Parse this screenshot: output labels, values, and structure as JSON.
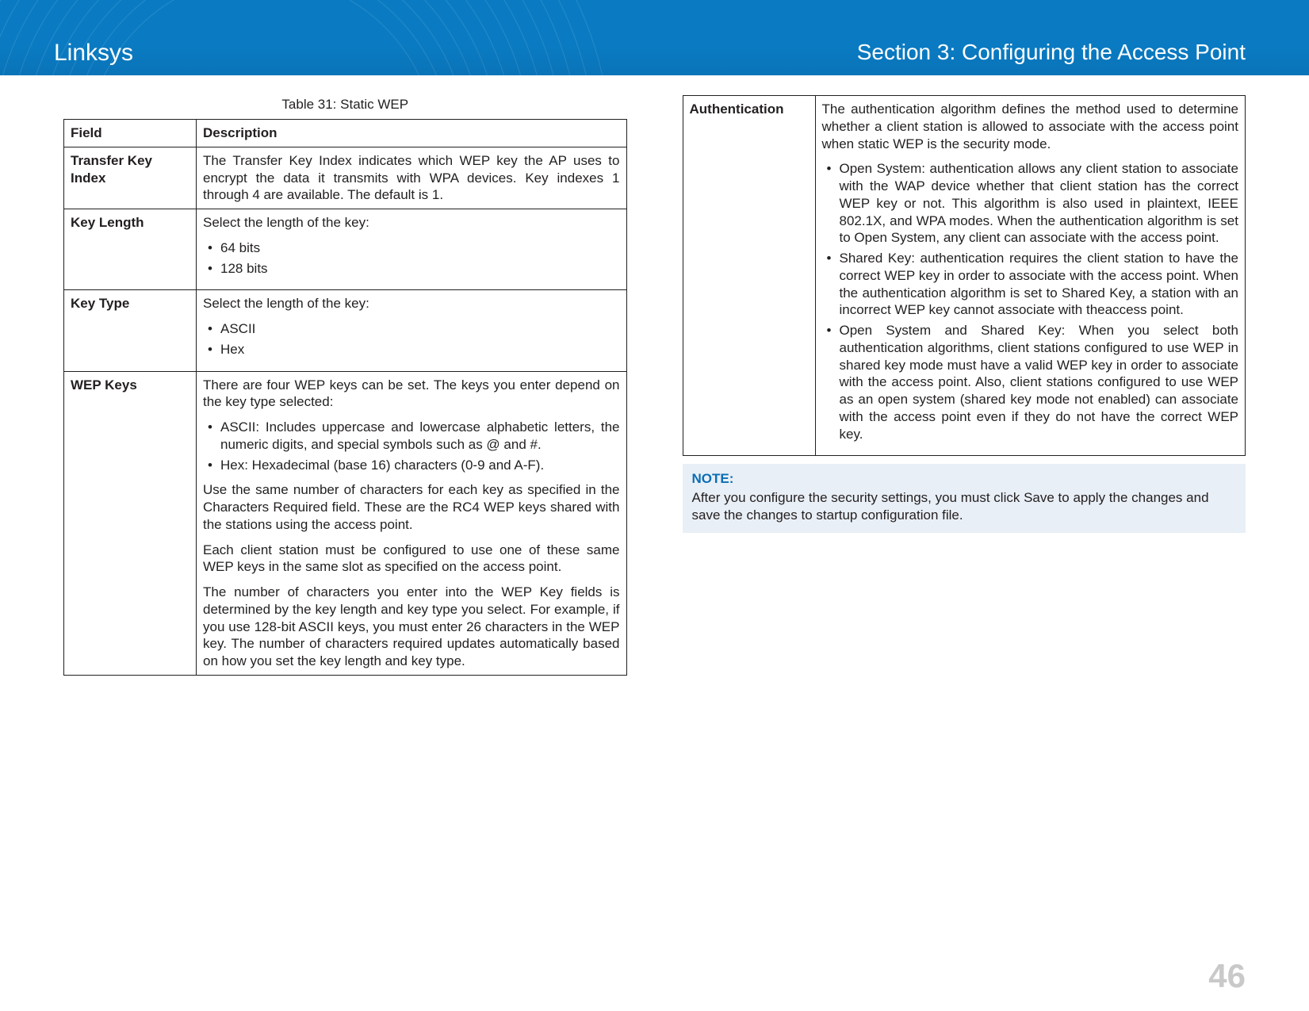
{
  "header": {
    "brand": "Linksys",
    "section_title": "Section 3:  Configuring the Access Point"
  },
  "table_left": {
    "caption": "Table 31: Static WEP",
    "headers": {
      "field": "Field",
      "description": "Description"
    },
    "rows": [
      {
        "field": "Transfer Key Index",
        "paras": [
          "The Transfer Key Index indicates which WEP key the AP uses to encrypt the data it transmits with WPA devices. Key indexes 1 through 4 are available. The default is 1."
        ]
      },
      {
        "field": "Key Length",
        "intro": "Select the length of the key:",
        "bullets": [
          "64 bits",
          "128 bits"
        ]
      },
      {
        "field": "Key Type",
        "intro": "Select the length of the key:",
        "bullets": [
          "ASCII",
          "Hex"
        ]
      },
      {
        "field": "WEP Keys",
        "intro": "There are four WEP keys can be set. The keys you enter depend on the key type selected:",
        "bullets": [
          "ASCII: Includes uppercase and lowercase alphabetic letters, the numeric digits, and special symbols such as @ and #.",
          "Hex: Hexadecimal (base 16) characters (0-9 and A-F)."
        ],
        "paras_after": [
          "Use the same number of characters for each key as specified in the Characters Required field. These are the RC4 WEP keys shared with the stations using the access point.",
          "Each client station must be configured to use one of these same WEP keys in the same slot as specified on the access point.",
          "The number of characters you enter into the WEP Key fields is determined by the key length and key type you select. For example, if you use 128-bit ASCII keys, you must enter 26 characters in the WEP key. The number of characters required updates automatically based on how you set the key length and key type."
        ]
      }
    ]
  },
  "table_right": {
    "rows": [
      {
        "field": "Authentication",
        "intro": "The authentication algorithm defines the method used to determine whether a client station is allowed to associate with the access point when static WEP is the security mode.",
        "bullets": [
          "Open System: authentication allows any client station to associate with the WAP device whether that client station has the correct WEP key or not. This algorithm is also used in plaintext, IEEE 802.1X, and WPA modes. When the authentication algorithm is set to Open System, any client can associate with the access point.",
          "Shared Key: authentication requires the client station to have the correct WEP key in order to associate with the access point. When the authentication algorithm is set to Shared Key, a station with an incorrect WEP key cannot associate with theaccess point.",
          "Open System and Shared Key: When you select both authentication algorithms, client stations configured to use WEP in shared key mode must have a valid WEP key in order to associate with the access point. Also, client stations configured to use WEP as an open system (shared key mode not enabled) can associate with the access point even if they do not have the correct WEP key."
        ]
      }
    ]
  },
  "note": {
    "title": "NOTE:",
    "body": "After you configure the security settings, you must click Save to apply the changes and save the changes to startup configuration file."
  },
  "page_number": "46"
}
